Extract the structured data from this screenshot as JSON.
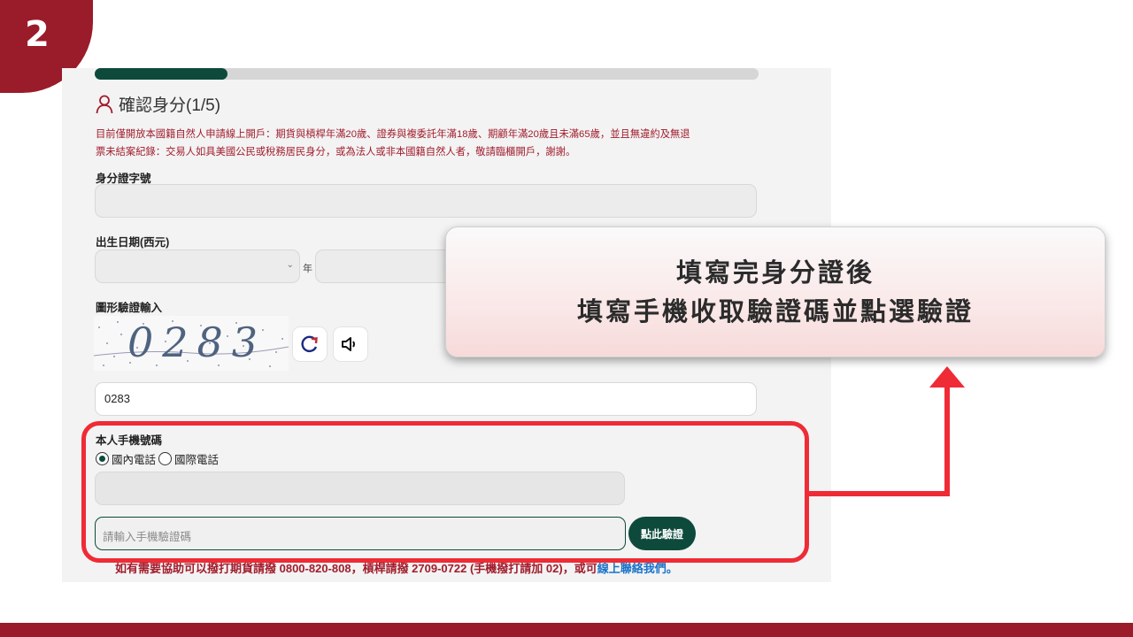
{
  "step": {
    "number": "2"
  },
  "form": {
    "progress": 0.2,
    "title": "確認身分(1/5)",
    "notice_line1": "目前僅開放本國籍自然人申請線上開戶：期貨與槓桿年滿20歲、證券與複委託年滿18歲、期顧年滿20歲且未滿65歲，並且無違約及無退",
    "notice_line2": "票未結案紀錄：交易人如具美國公民或稅務居民身分，或為法人或非本國籍自然人者，敬請臨櫃開戶，謝謝。",
    "id_label": "身分證字號",
    "birth_label": "出生日期(西元)",
    "year_suffix": "年",
    "captcha_label": "圖形驗證輸入",
    "captcha_code": "0283",
    "captcha_input_value": "0283",
    "phone_label": "本人手機號碼",
    "radio_domestic": "國內電話",
    "radio_international": "國際電話",
    "otp_placeholder": "請輸入手機驗證碼",
    "verify_button": "點此驗證",
    "help_text": "如有需要協助可以撥打期貨請撥 0800-820-808，槓桿請撥 2709-0722 (手機撥打請加 02)，或可",
    "help_link": "線上聯絡我們。"
  },
  "callout": {
    "line1": "填寫完身分證後",
    "line2": "填寫手機收取驗證碼並點選驗證"
  },
  "colors": {
    "brand": "#9a1b2a",
    "accent": "#0d4a3c",
    "highlight": "#ef2b36"
  },
  "icons": [
    "user-icon",
    "refresh-icon",
    "speaker-icon",
    "chevron-down-icon"
  ]
}
